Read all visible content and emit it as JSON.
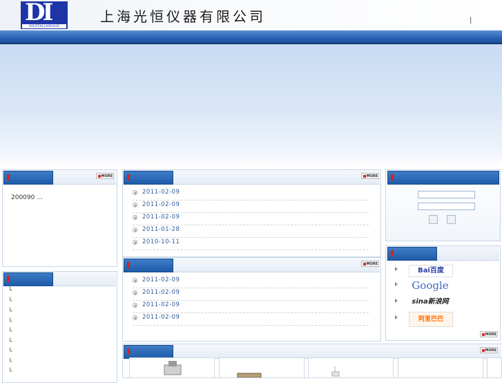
{
  "header": {
    "logo_letters": "DI",
    "logo_caption": "DIGITALIAMAGE",
    "company_name": "上海光恒仪器有限公司",
    "separator": "|"
  },
  "more_label": "MORE",
  "left_top_panel": {
    "text": "200090 …"
  },
  "left_bottom_panel": {
    "items": [
      "└",
      "└",
      "└",
      "└",
      "└",
      "└",
      "└",
      "└",
      "└"
    ]
  },
  "news_panel_1": {
    "dates": [
      "2011-02-09",
      "2011-02-09",
      "2011-02-09",
      "2011-01-28",
      "2010-10-11"
    ]
  },
  "news_panel_2": {
    "dates": [
      "2011-02-09",
      "2011-02-09",
      "2011-02-09",
      "2011-02-09"
    ]
  },
  "links": [
    {
      "name": "Baidu",
      "label": "Bai百度"
    },
    {
      "name": "Google",
      "label": "Google"
    },
    {
      "name": "Sina",
      "label": "sina新浪网"
    },
    {
      "name": "Alibaba",
      "label": "阿里巴巴"
    }
  ],
  "colors": {
    "navbar": "#2a63b5",
    "accent_red": "#d62222",
    "date_text": "#2d5c9a"
  }
}
